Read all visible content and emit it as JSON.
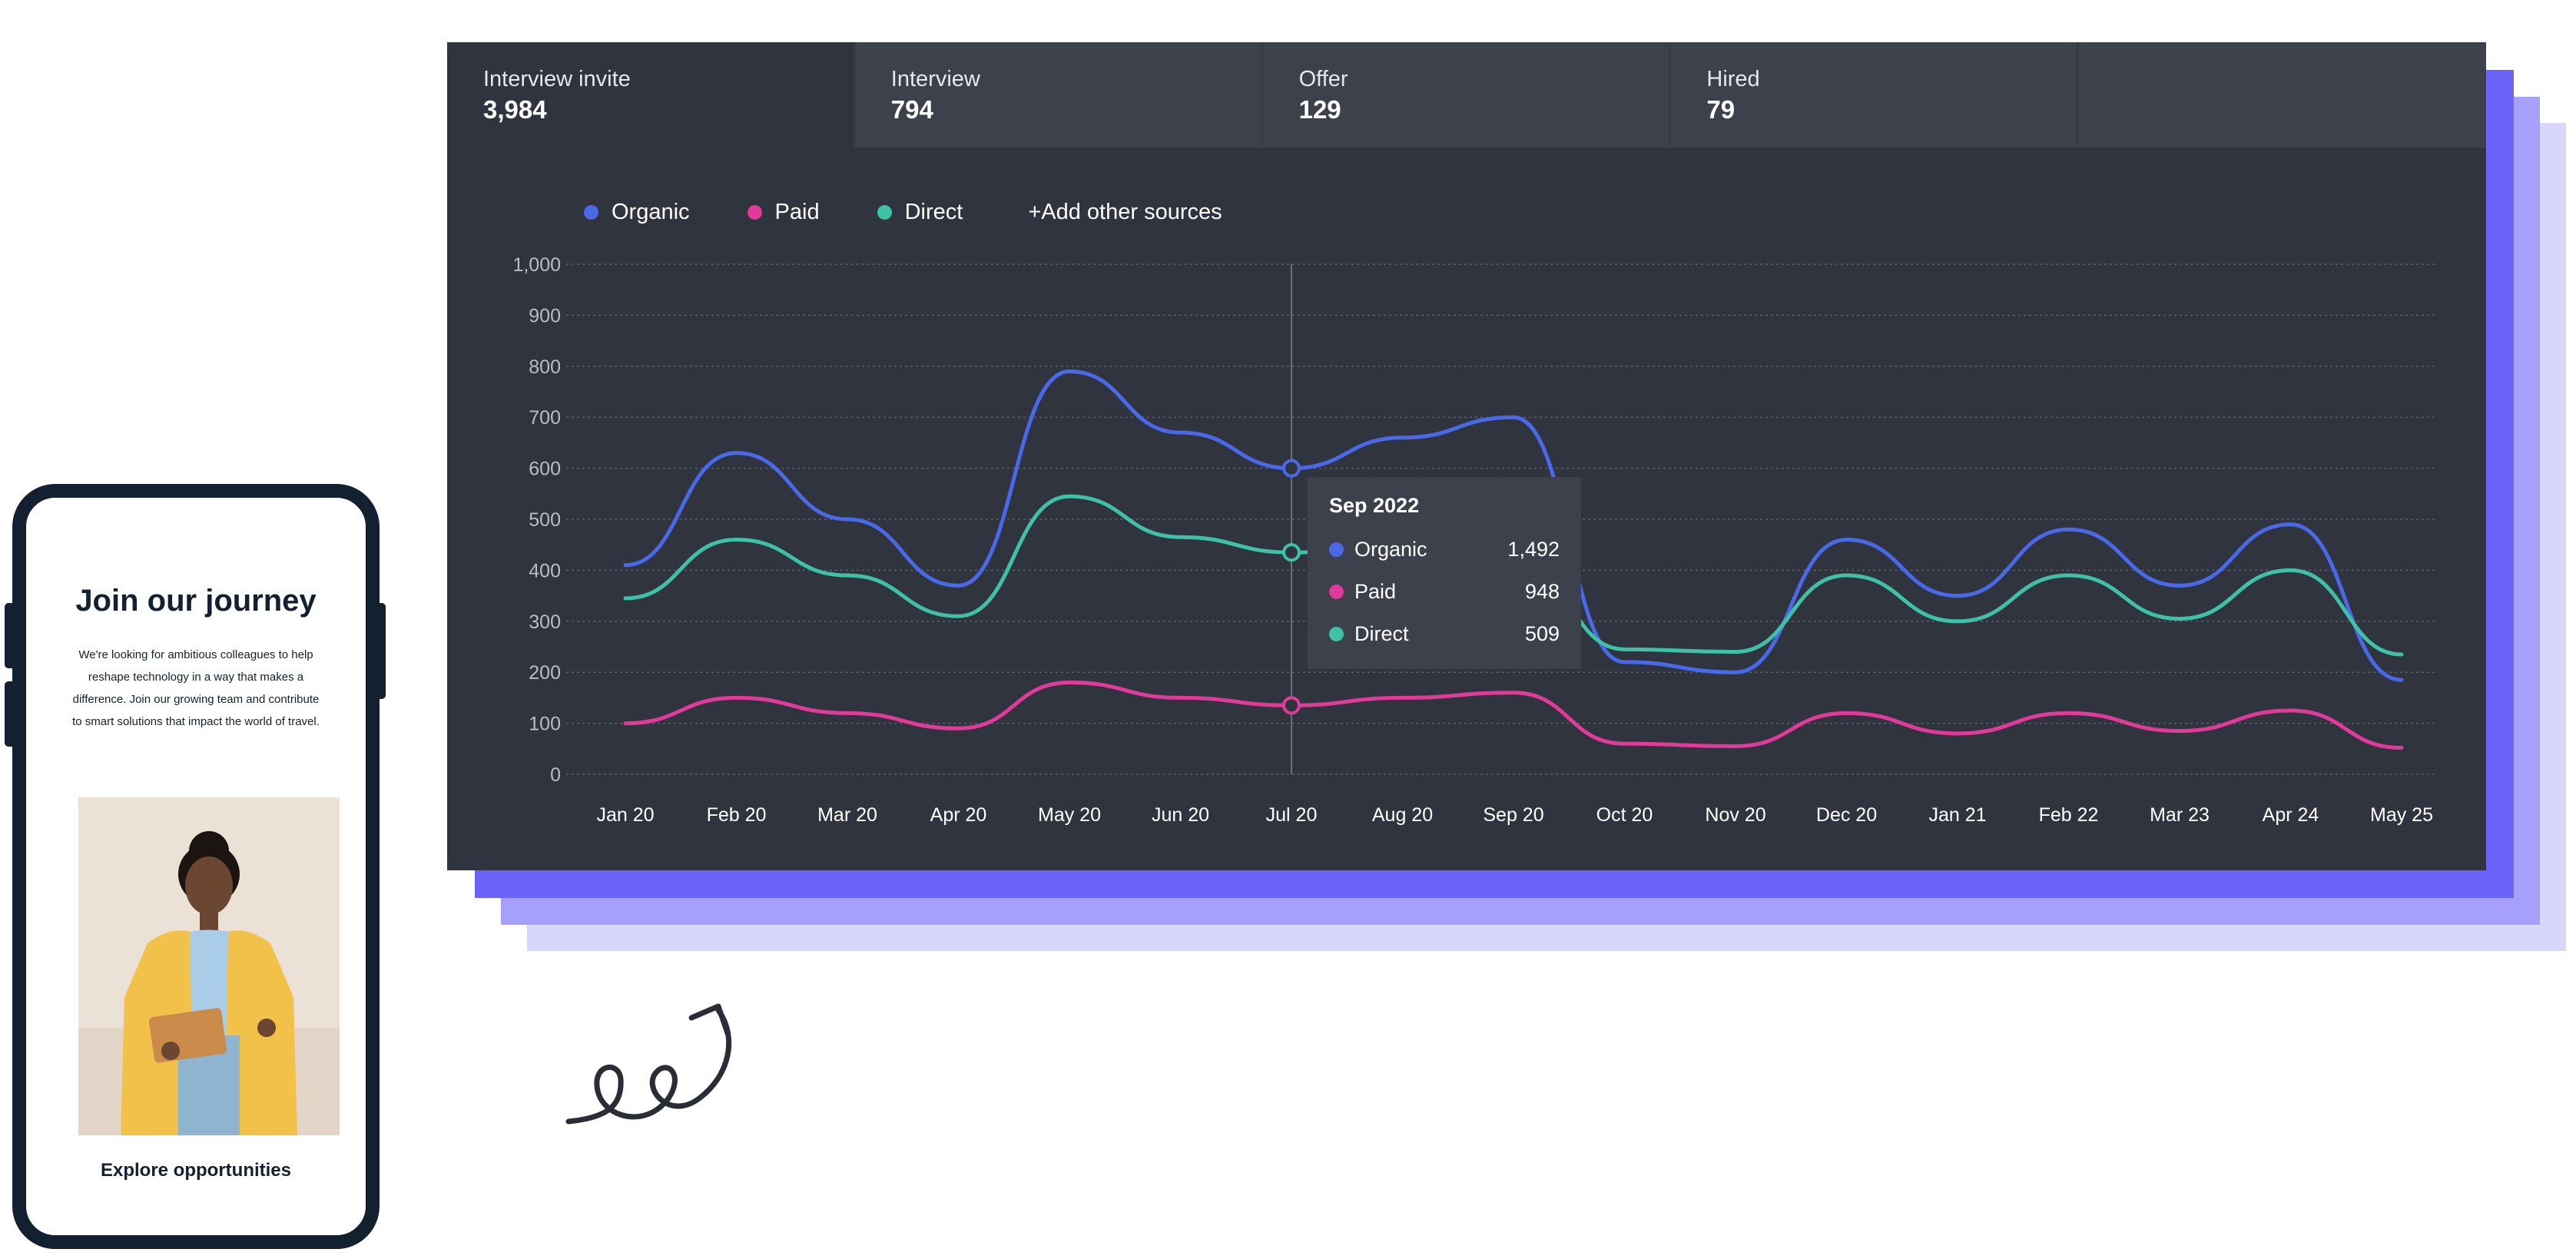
{
  "kpis": [
    {
      "label": "Interview invite",
      "value": "3,984",
      "active": true
    },
    {
      "label": "Interview",
      "value": "794",
      "active": false
    },
    {
      "label": "Offer",
      "value": "129",
      "active": false
    },
    {
      "label": "Hired",
      "value": "79",
      "active": false
    },
    {
      "label": "",
      "value": "",
      "active": false
    }
  ],
  "legend": {
    "items": [
      {
        "label": "Organic",
        "color": "#4a69e8"
      },
      {
        "label": "Paid",
        "color": "#e03a9a"
      },
      {
        "label": "Direct",
        "color": "#3ec1a6"
      }
    ],
    "add_label": "+Add other sources"
  },
  "tooltip": {
    "title": "Sep 2022",
    "rows": [
      {
        "name": "Organic",
        "value": "1,492",
        "color": "#4a69e8"
      },
      {
        "name": "Paid",
        "value": "948",
        "color": "#e03a9a"
      },
      {
        "name": "Direct",
        "value": "509",
        "color": "#3ec1a6"
      }
    ]
  },
  "chart_data": {
    "type": "line",
    "categories": [
      "Jan 20",
      "Feb 20",
      "Mar 20",
      "Apr 20",
      "May 20",
      "Jun 20",
      "Jul 20",
      "Aug 20",
      "Sep 20",
      "Oct 20",
      "Nov 20",
      "Dec 20",
      "Jan 21",
      "Feb 22",
      "Mar 23",
      "Apr 24",
      "May 25"
    ],
    "ylim": [
      0,
      1000
    ],
    "yticks": [
      0,
      100,
      200,
      300,
      400,
      500,
      600,
      700,
      800,
      900,
      1000
    ],
    "ytick_labels": [
      "0",
      "100",
      "200",
      "300",
      "400",
      "500",
      "600",
      "700",
      "800",
      "900",
      "1,000"
    ],
    "grid": true,
    "series": [
      {
        "name": "Organic",
        "color": "#4a69e8",
        "values": [
          410,
          630,
          500,
          370,
          790,
          670,
          600,
          660,
          700,
          220,
          200,
          460,
          350,
          480,
          370,
          490,
          185
        ]
      },
      {
        "name": "Paid",
        "color": "#e03a9a",
        "values": [
          100,
          150,
          120,
          90,
          180,
          150,
          135,
          150,
          160,
          60,
          55,
          120,
          80,
          120,
          85,
          125,
          52
        ]
      },
      {
        "name": "Direct",
        "color": "#3ec1a6",
        "values": [
          345,
          460,
          390,
          310,
          545,
          465,
          435,
          450,
          425,
          245,
          240,
          390,
          300,
          390,
          305,
          400,
          235
        ]
      }
    ],
    "highlight_index": 6
  },
  "phone": {
    "title": "Join our journey",
    "text": "We're looking for ambitious colleagues to help reshape technology in a way that makes a difference. Join our growing team and contribute to smart solutions that impact the world of travel.",
    "cta": "Explore opportunities"
  }
}
